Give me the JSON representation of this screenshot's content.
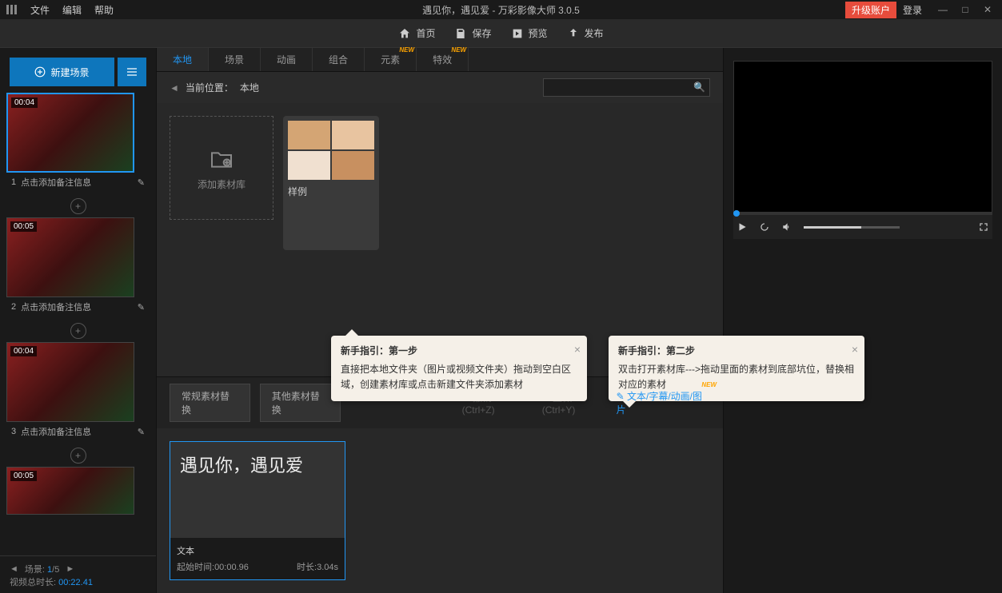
{
  "titlebar": {
    "menu": [
      "文件",
      "编辑",
      "帮助"
    ],
    "title": "遇见你，遇见爱 - 万彩影像大师 3.0.5",
    "upgrade": "升级账户",
    "login": "登录"
  },
  "toolbar": {
    "home": "首页",
    "save": "保存",
    "preview": "预览",
    "publish": "发布"
  },
  "left": {
    "new_scene": "新建场景",
    "scenes": [
      {
        "time": "00:04",
        "num": "1",
        "caption": "点击添加备注信息"
      },
      {
        "time": "00:05",
        "num": "2",
        "caption": "点击添加备注信息"
      },
      {
        "time": "00:04",
        "num": "3",
        "caption": "点击添加备注信息"
      },
      {
        "time": "00:05",
        "num": "",
        "caption": ""
      }
    ],
    "scene_label": "场景:",
    "scene_cur": "1",
    "scene_sep": "/",
    "scene_total": "5",
    "dur_label": "视频总时长:",
    "dur_val": "00:22.41"
  },
  "tabs": [
    "本地",
    "场景",
    "动画",
    "组合",
    "元素",
    "特效"
  ],
  "breadcrumb": {
    "label": "当前位置：",
    "path": "本地"
  },
  "assets": {
    "add": "添加素材库",
    "sample": "样例"
  },
  "tip1": {
    "title": "新手指引：第一步",
    "body": "直接把本地文件夹（图片或视频文件夹）拖动到空白区域，创建素材库或点击新建文件夹添加素材"
  },
  "tip2": {
    "title": "新手指引：第二步",
    "body": "双击打开素材库--->拖动里面的素材到底部坑位，替换相对应的素材"
  },
  "replace": {
    "tab1": "常规素材替换",
    "tab2": "其他素材替换",
    "undo": "撤销 (Ctrl+Z)",
    "redo": "重做 (Ctrl+Y)",
    "textlink": "文本/字幕/动画/图片"
  },
  "clip": {
    "preview_text": "遇见你，遇见爱",
    "label": "文本",
    "start_label": "起始时间:",
    "start": "00:00.96",
    "dur_label": "时长:",
    "dur": "3.04s"
  }
}
